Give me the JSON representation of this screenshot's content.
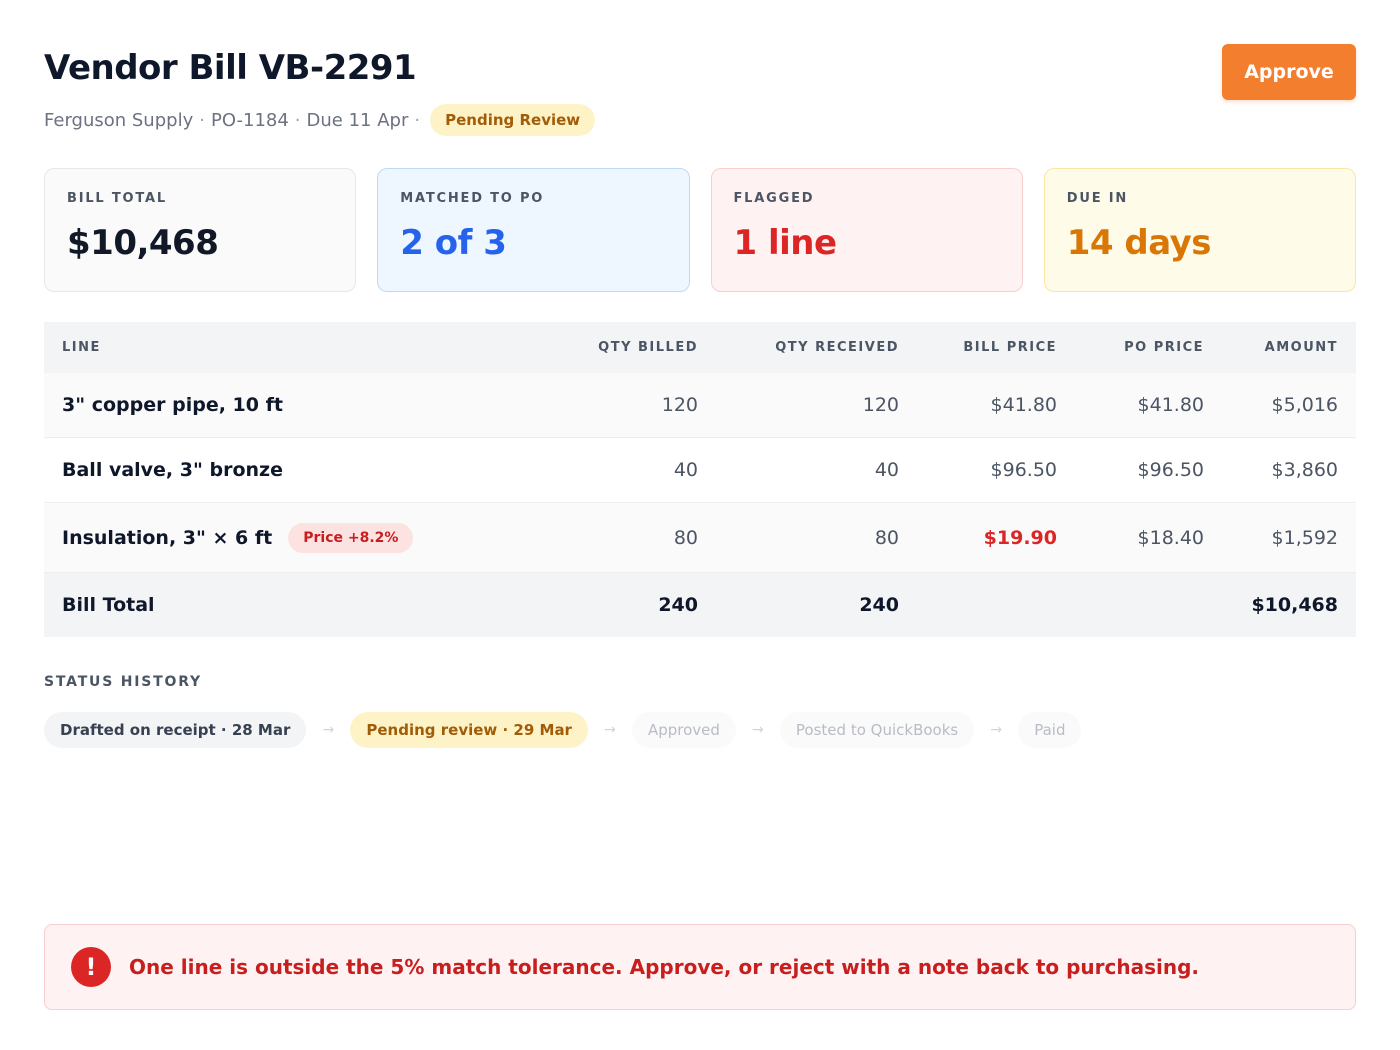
{
  "header": {
    "title": "Vendor Bill VB-2291",
    "vendor": "Ferguson Supply",
    "po": "PO-1184",
    "due": "Due 11 Apr",
    "status": "Pending Review",
    "approve_label": "Approve"
  },
  "stats": [
    {
      "label": "BILL TOTAL",
      "value": "$10,468"
    },
    {
      "label": "MATCHED TO PO",
      "value": "2 of 3"
    },
    {
      "label": "FLAGGED",
      "value": "1 line"
    },
    {
      "label": "DUE IN",
      "value": "14 days"
    }
  ],
  "table": {
    "headers": [
      "LINE",
      "QTY BILLED",
      "QTY RECEIVED",
      "BILL PRICE",
      "PO PRICE",
      "AMOUNT"
    ],
    "rows": [
      {
        "line": "3\" copper pipe, 10 ft",
        "qty_billed": "120",
        "qty_received": "120",
        "bill_price": "$41.80",
        "po_price": "$41.80",
        "amount": "$5,016"
      },
      {
        "line": "Ball valve, 3\" bronze",
        "qty_billed": "40",
        "qty_received": "40",
        "bill_price": "$96.50",
        "po_price": "$96.50",
        "amount": "$3,860"
      },
      {
        "line": "Insulation, 3\" × 6 ft",
        "flag": "Price +8.2%",
        "qty_billed": "80",
        "qty_received": "80",
        "bill_price": "$19.90",
        "po_price": "$18.40",
        "amount": "$1,592"
      }
    ],
    "total": {
      "label": "Bill Total",
      "qty_billed": "240",
      "qty_received": "240",
      "amount": "$10,468"
    }
  },
  "history": {
    "title": "STATUS HISTORY",
    "steps": [
      {
        "label": "Drafted on receipt · 28 Mar",
        "state": "done"
      },
      {
        "label": "Pending review · 29 Mar",
        "state": "current"
      },
      {
        "label": "Approved",
        "state": "future"
      },
      {
        "label": "Posted to QuickBooks",
        "state": "future"
      },
      {
        "label": "Paid",
        "state": "future"
      }
    ],
    "arrow": "→"
  },
  "alert": {
    "icon": "!",
    "text": "One line is outside the 5% match tolerance. Approve, or reject with a note back to purchasing."
  },
  "colors": {
    "accent": "#f37e2e",
    "flag_red": "#dc2626",
    "match_blue": "#2563eb",
    "due_amber": "#d97706"
  }
}
